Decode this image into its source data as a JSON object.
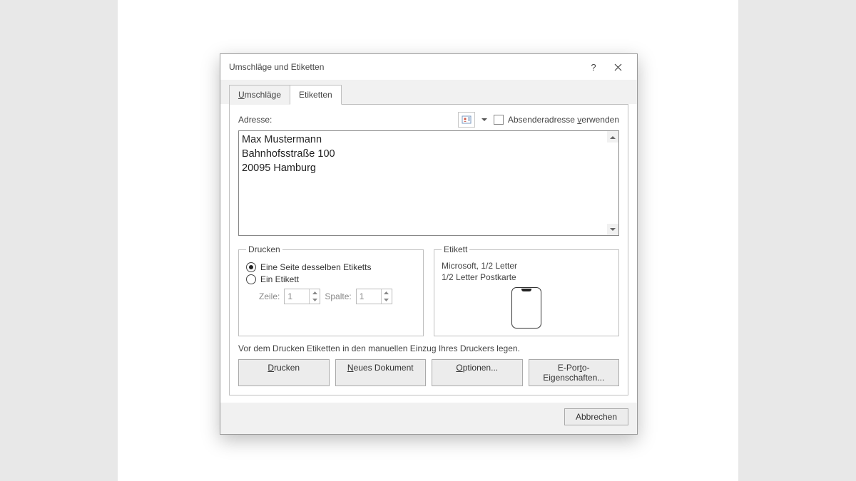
{
  "dialog": {
    "title": "Umschläge und Etiketten"
  },
  "tabs": {
    "umschlaege": "Umschläge",
    "etiketten": "Etiketten"
  },
  "address": {
    "label": "Adresse:",
    "use_sender_prefix": "Absenderadresse ",
    "use_sender_ul": "v",
    "use_sender_suffix": "erwenden",
    "value": "Max Mustermann\nBahnhofsstraße 100\n20095 Hamburg"
  },
  "print_group": {
    "legend": "Drucken",
    "full_page_ul": "E",
    "full_page_rest": "ine Seite desselben Etiketts",
    "single_label": "Ein Etikett",
    "row_label": "Zeile:",
    "col_label": "Spalte:",
    "row_val": "1",
    "col_val": "1"
  },
  "label_group": {
    "legend": "Etikett",
    "line1": "Microsoft, 1/2 Letter",
    "line2": "1/2 Letter Postkarte"
  },
  "hint": "Vor dem Drucken Etiketten in den manuellen Einzug Ihres Druckers legen.",
  "buttons": {
    "print_ul": "D",
    "print_rest": "rucken",
    "newdoc_ul": "N",
    "newdoc_rest": "eues Dokument",
    "options_ul": "O",
    "options_rest": "ptionen...",
    "eporto_prefix": "E-Por",
    "eporto_ul": "t",
    "eporto_rest": "o-Eigenschaften...",
    "cancel": "Abbrechen"
  }
}
